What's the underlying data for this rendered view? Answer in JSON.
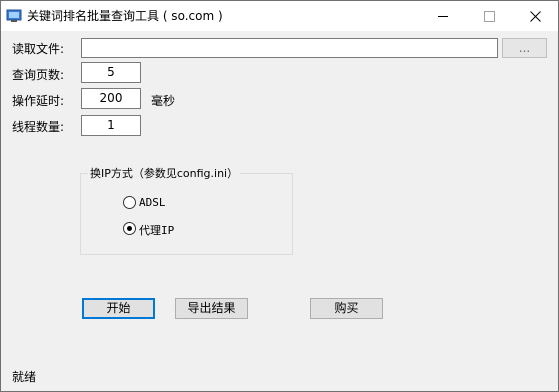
{
  "window": {
    "title": "关键词排名批量查询工具 ( so.com )"
  },
  "form": {
    "read_file_label": "读取文件:",
    "read_file_value": "",
    "browse_label": "...",
    "pages_label": "查询页数:",
    "pages_value": "5",
    "delay_label": "操作延时:",
    "delay_value": "200",
    "delay_unit": "毫秒",
    "threads_label": "线程数量:",
    "threads_value": "1"
  },
  "ip_group": {
    "title": "换IP方式（参数见config.ini）",
    "options": [
      {
        "label": "ADSL",
        "selected": false
      },
      {
        "label": "代理IP",
        "selected": true
      }
    ]
  },
  "buttons": {
    "start": "开始",
    "export": "导出结果",
    "buy": "购买"
  },
  "status": {
    "text": "就绪"
  }
}
